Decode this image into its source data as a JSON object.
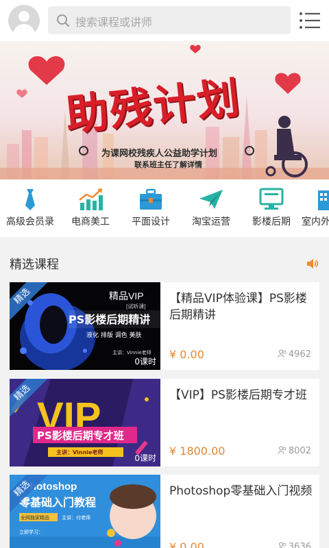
{
  "header": {
    "search_placeholder": "搜索课程或讲师"
  },
  "banner": {
    "title": "助残计划",
    "subtitle": "为课网校残疾人公益助学计划",
    "subtitle2": "联系班主任了解详情"
  },
  "categories": [
    {
      "label": "高级会员录",
      "icon": "tie-icon"
    },
    {
      "label": "电商美工",
      "icon": "growth-chart-icon"
    },
    {
      "label": "平面设计",
      "icon": "briefcase-icon"
    },
    {
      "label": "淘宝运营",
      "icon": "paper-plane-icon"
    },
    {
      "label": "影楼后期",
      "icon": "monitor-icon"
    },
    {
      "label": "室内外",
      "icon": "building-icon"
    }
  ],
  "featured": {
    "title": "精选课程",
    "courses": [
      {
        "title": "【精品VIP体验课】PS影楼后期精讲",
        "price": "¥ 0.00",
        "count": "4962",
        "badge": "精选",
        "lessons": "0课时",
        "thumb_title": "PS影楼后期精讲",
        "thumb_tag": "精品VIP",
        "thumb_tag_small": "[试听课]",
        "thumb_sub": "液化  排版  调色  美肤",
        "thumb_teacher": "主讲：Vinnie老师"
      },
      {
        "title": "【VIP】PS影楼后期专才班",
        "price": "¥ 1800.00",
        "count": "8002",
        "badge": "精选",
        "lessons": "0课时",
        "thumb_big": "VIP",
        "thumb_title": "PS影楼后期专才班",
        "thumb_teacher": "主讲：Vinnie老师"
      },
      {
        "title": "Photoshop零基础入门视频",
        "price": "¥ 0.00",
        "count": "3636",
        "badge": "精选",
        "thumb_title1": "hotoshop",
        "thumb_title2": "零基础入门教程",
        "thumb_tag": "全网独家精品",
        "thumb_teacher": "主讲：付老师",
        "thumb_foot": "立即学习："
      }
    ]
  },
  "colors": {
    "accent": "#e8862e",
    "icon_blue": "#2b9ad6",
    "icon_teal": "#27b3a4",
    "icon_orange": "#f08a30"
  }
}
